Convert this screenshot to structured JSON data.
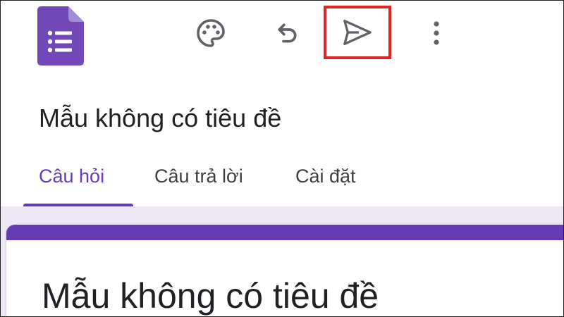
{
  "toolbar": {
    "app_icon": "google-forms-icon",
    "palette_icon": "palette-icon",
    "undo_icon": "undo-icon",
    "send_icon": "send-icon",
    "more_icon": "more-vert-icon",
    "highlight_color": "#e2232a"
  },
  "header": {
    "form_title": "Mẫu không có tiêu đề"
  },
  "tabs": [
    {
      "label": "Câu hỏi",
      "active": true
    },
    {
      "label": "Câu trả lời",
      "active": false
    },
    {
      "label": "Cài đặt",
      "active": false
    }
  ],
  "form": {
    "title": "Mẫu không có tiêu đề"
  },
  "colors": {
    "accent": "#673ab7",
    "background_tint": "#ede7f6",
    "icon": "#5f6368"
  }
}
